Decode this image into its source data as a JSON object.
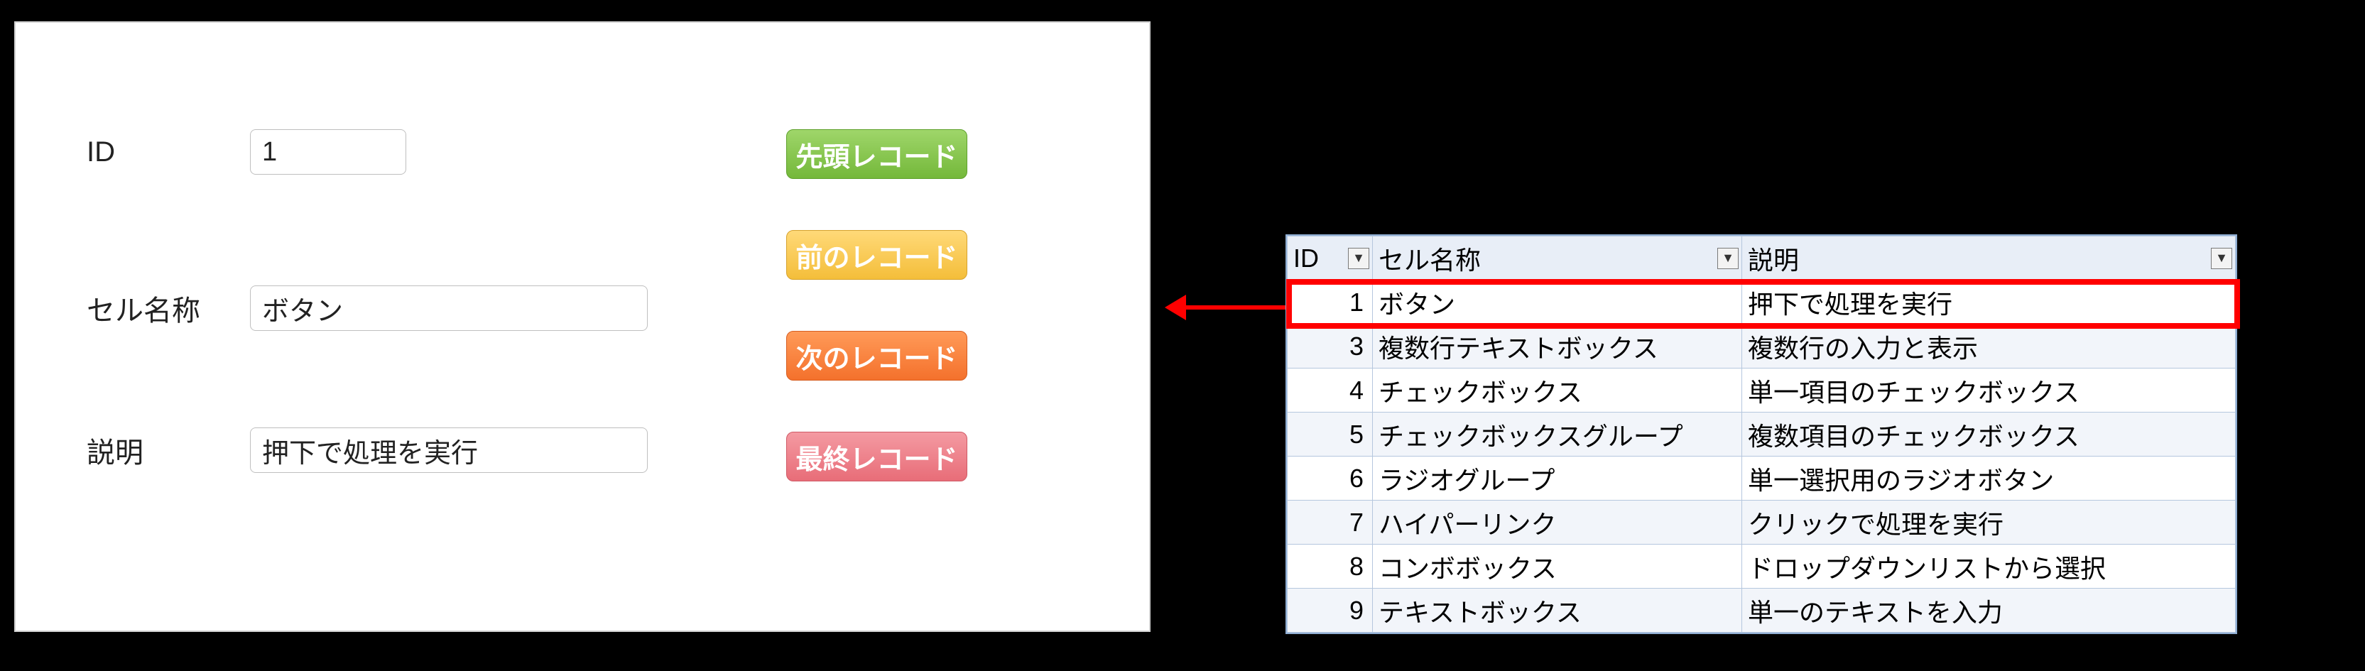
{
  "form": {
    "labels": {
      "id": "ID",
      "name": "セル名称",
      "desc": "説明"
    },
    "values": {
      "id": "1",
      "name": "ボタン",
      "desc": "押下で処理を実行"
    }
  },
  "nav": {
    "first": "先頭レコード",
    "prev": "前のレコード",
    "next": "次のレコード",
    "last": "最終レコード"
  },
  "grid": {
    "headers": {
      "id": "ID",
      "name": "セル名称",
      "desc": "説明"
    },
    "highlight_row_index": 0,
    "rows": [
      {
        "id": "1",
        "name": "ボタン",
        "desc": "押下で処理を実行"
      },
      {
        "id": "3",
        "name": "複数行テキストボックス",
        "desc": "複数行の入力と表示"
      },
      {
        "id": "4",
        "name": "チェックボックス",
        "desc": "単一項目のチェックボックス"
      },
      {
        "id": "5",
        "name": "チェックボックスグループ",
        "desc": "複数項目のチェックボックス"
      },
      {
        "id": "6",
        "name": "ラジオグループ",
        "desc": "単一選択用のラジオボタン"
      },
      {
        "id": "7",
        "name": "ハイパーリンク",
        "desc": "クリックで処理を実行"
      },
      {
        "id": "8",
        "name": "コンボボックス",
        "desc": "ドロップダウンリストから選択"
      },
      {
        "id": "9",
        "name": "テキストボックス",
        "desc": "単一のテキストを入力"
      }
    ]
  },
  "icons": {
    "chevron_down": "▼"
  }
}
